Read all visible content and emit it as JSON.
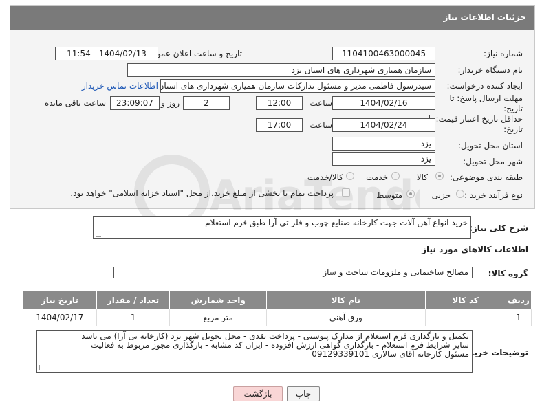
{
  "header": {
    "title": "جزئیات اطلاعات نیاز"
  },
  "fields": {
    "need_number_label": "شماره نیاز:",
    "need_number": "1104100463000045",
    "announce_label": "تاریخ و ساعت اعلان عمومی:",
    "announce_value": "1404/02/13 - 11:54",
    "buyer_org_label": "نام دستگاه خریدار:",
    "buyer_org": "سازمان همیاری شهرداری های استان یزد",
    "creator_label": "ایجاد کننده درخواست:",
    "creator": "سیدرسول فاطمی مدیر و مسئول تدارکات سازمان همیاری شهرداری های استان یزد",
    "contact_link": "اطلاعات تماس خریدار",
    "deadline_label": "مهلت ارسال پاسخ: تا تاریخ:",
    "deadline_date": "1404/02/16",
    "time_label": "ساعت",
    "deadline_time": "12:00",
    "days_value": "2",
    "days_label": "روز و",
    "remaining_time": "23:09:07",
    "remaining_label": "ساعت باقی مانده",
    "validity_label": "حداقل تاریخ اعتبار قیمت: تا تاریخ:",
    "validity_date": "1404/02/24",
    "validity_time_label": "ساعت",
    "validity_time": "17:00",
    "province_label": "استان محل تحویل:",
    "province": "یزد",
    "city_label": "شهر محل تحویل:",
    "city": "یزد",
    "category_label": "طبقه بندی موضوعی:",
    "category_options": [
      "کالا",
      "خدمت",
      "کالا/خدمت"
    ],
    "process_label": "نوع فرآیند خرید :",
    "process_options": [
      "جزیی",
      "متوسط"
    ],
    "process_note": "پرداخت تمام یا بخشی از مبلغ خرید،از محل \"اسناد خزانه اسلامی\" خواهد بود."
  },
  "description": {
    "label": "شرح کلی نیاز:",
    "text": "خرید انواع آهن آلات جهت کارخانه صنایع چوب و فلز تی آرا طبق فرم استعلام"
  },
  "goods": {
    "section_title": "اطلاعات کالاهای مورد نیاز",
    "group_label": "گروه کالا:",
    "group_value": "مصالح ساختمانی و ملزومات ساخت و ساز",
    "columns": [
      "ردیف",
      "کد کالا",
      "نام کالا",
      "واحد شمارش",
      "تعداد / مقدار",
      "تاریخ نیاز"
    ],
    "rows": [
      [
        "1",
        "--",
        "ورق آهنی",
        "متر مربع",
        "1",
        "1404/02/17"
      ]
    ]
  },
  "buyer_notes": {
    "label": "توضیحات خریدار:",
    "lines": [
      "تکمیل و بارگذاری فرم استعلام از مدارک پیوستی - پرداخت نقدی - محل تحویل شهر یزد (کارخانه تی آرا) می باشد",
      "سایر شرایط فرم استعلام - بارگذاری گواهی ارزش افزوده - ایران کد مشابه - بارگذاری مجوز مربوط به فعالیت",
      "مسئول کارخانه آقای سالاری 09129339101"
    ]
  },
  "buttons": {
    "print": "چاپ",
    "back": "بازگشت"
  },
  "watermark": {
    "text": "AriaTender.neT"
  }
}
